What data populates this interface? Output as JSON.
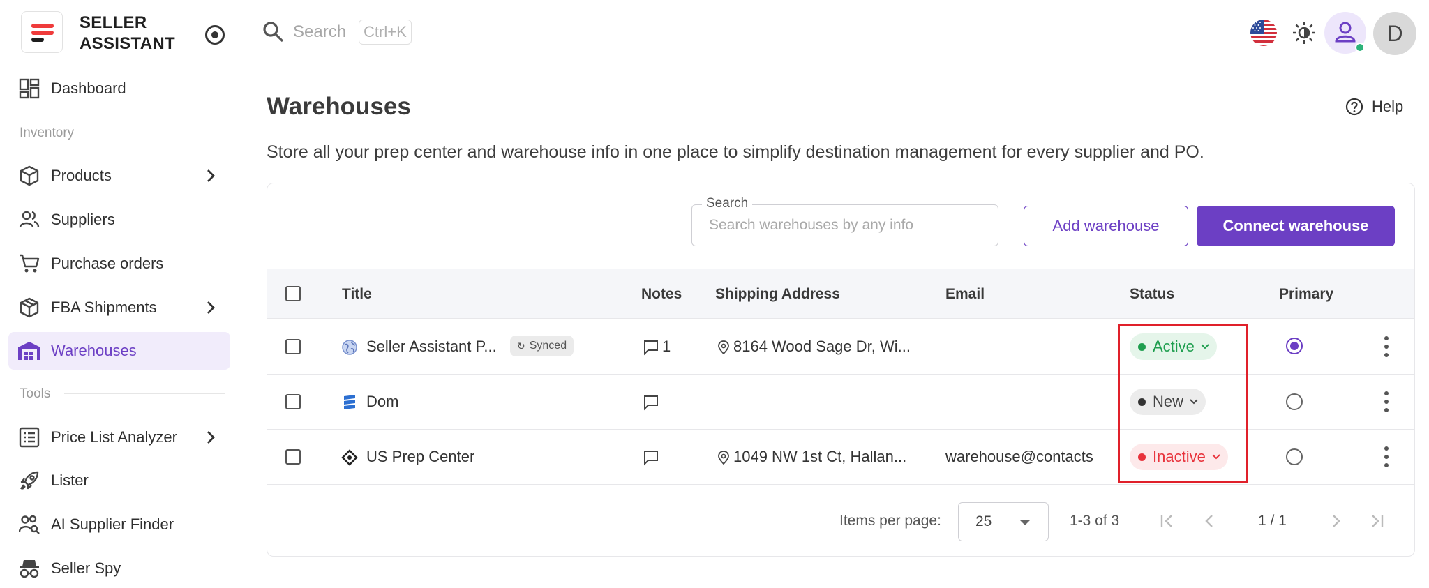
{
  "app": {
    "brand_line1": "SELLER",
    "brand_line2": "ASSISTANT"
  },
  "topbar": {
    "search_placeholder": "Search",
    "shortcut": "Ctrl+K",
    "avatar_letter": "D"
  },
  "sidebar": {
    "dashboard": "Dashboard",
    "section_inventory": "Inventory",
    "products": "Products",
    "suppliers": "Suppliers",
    "purchase_orders": "Purchase orders",
    "fba_shipments": "FBA Shipments",
    "warehouses": "Warehouses",
    "section_tools": "Tools",
    "price_list_analyzer": "Price List Analyzer",
    "lister": "Lister",
    "ai_supplier_finder": "AI Supplier Finder",
    "seller_spy": "Seller Spy"
  },
  "page": {
    "title": "Warehouses",
    "help": "Help",
    "subtitle": "Store all your prep center and warehouse info in one place to simplify destination management for every supplier and PO."
  },
  "toolbar": {
    "search_label": "Search",
    "search_placeholder": "Search warehouses by any info",
    "add_button": "Add warehouse",
    "connect_button": "Connect warehouse"
  },
  "table": {
    "columns": {
      "title": "Title",
      "notes": "Notes",
      "address": "Shipping Address",
      "email": "Email",
      "status": "Status",
      "primary": "Primary"
    },
    "rows": [
      {
        "title": "Seller Assistant P...",
        "badge": "Synced",
        "notes": "1",
        "address": "8164 Wood Sage Dr, Wi...",
        "email": "",
        "status": "Active",
        "primary": true
      },
      {
        "title": "Dom",
        "badge": "",
        "notes": "",
        "address": "",
        "email": "",
        "status": "New",
        "primary": false
      },
      {
        "title": "US Prep Center",
        "badge": "",
        "notes": "",
        "address": "1049 NW 1st Ct, Hallan...",
        "email": "warehouse@contacts",
        "status": "Inactive",
        "primary": false
      }
    ]
  },
  "pagination": {
    "items_per_page_label": "Items per page:",
    "items_per_page": "25",
    "range": "1-3 of 3",
    "page": "1 / 1"
  },
  "colors": {
    "accent": "#6c3fc4",
    "active_green": "#1e9e4e",
    "inactive_red": "#e8333c",
    "highlight_border": "#e0202a"
  }
}
